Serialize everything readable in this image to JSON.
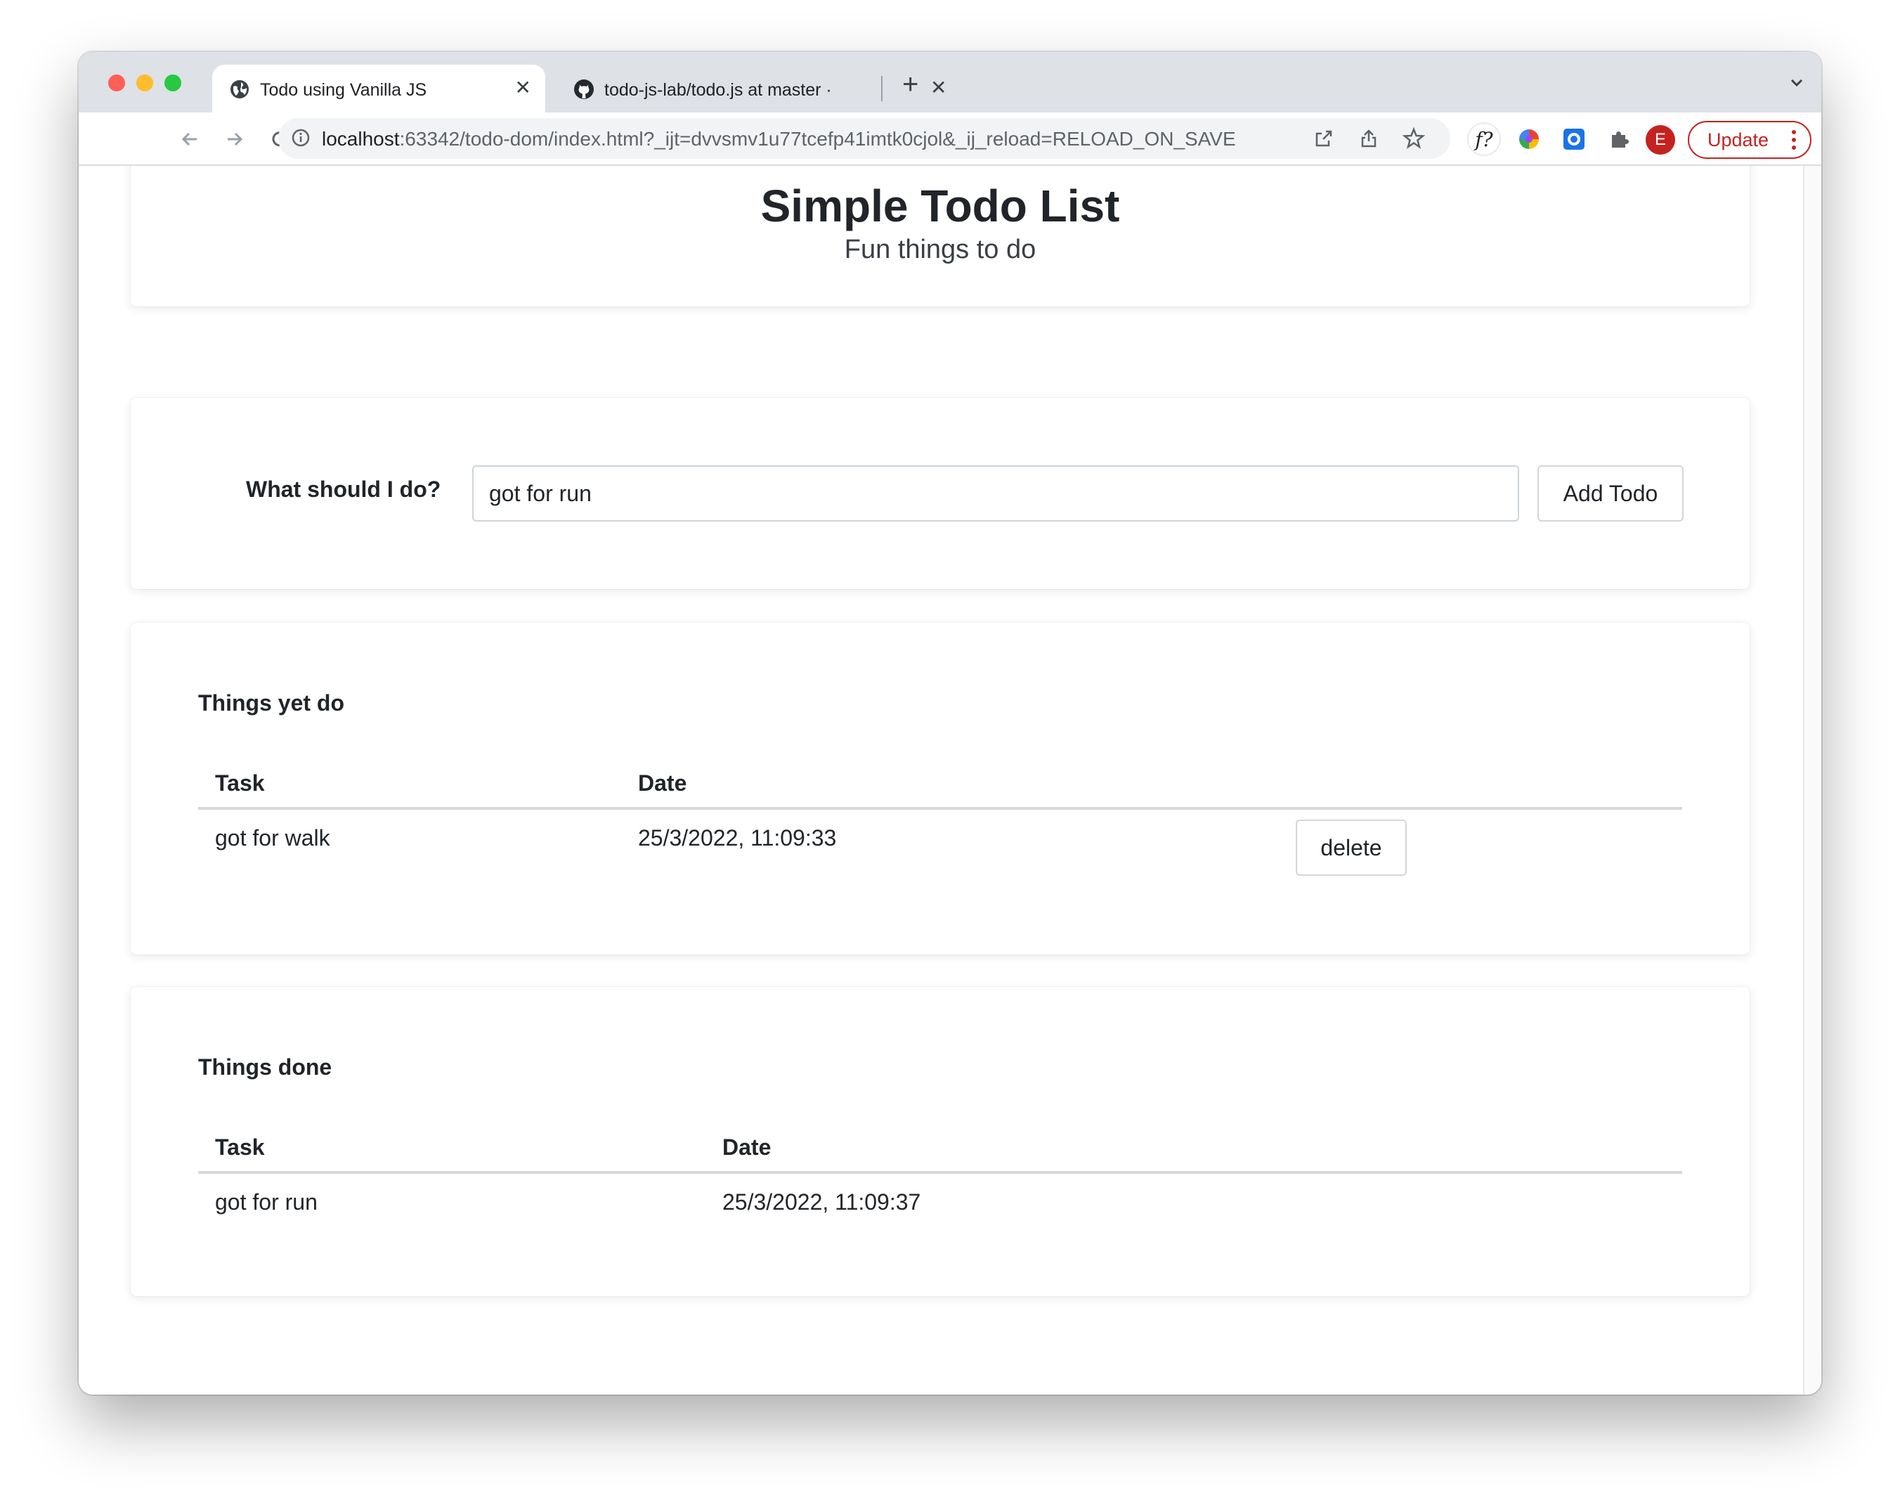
{
  "browser": {
    "tabs": [
      {
        "title": "Todo using Vanilla JS",
        "active": true,
        "icon": "globe-icon"
      },
      {
        "title": "todo-js-lab/todo.js at master · ",
        "active": false,
        "icon": "github-icon"
      }
    ],
    "new_tab_label": "+",
    "close_label": "✕",
    "url_host": "localhost",
    "url_rest": ":63342/todo-dom/index.html?_ijt=dvvsmv1u77tcefp41imtk0cjol&_ij_reload=RELOAD_ON_SAVE",
    "extension_label": "f?",
    "avatar_letter": "E",
    "update_label": "Update",
    "colors": {
      "update": "#c5221f",
      "tabstrip": "#dee1e6"
    }
  },
  "header": {
    "title": "Simple Todo List",
    "subtitle": "Fun things to do"
  },
  "form": {
    "label": "What should I do?",
    "input_value": "got for run",
    "add_button": "Add Todo"
  },
  "todo": {
    "title": "Things yet do",
    "columns": [
      "Task",
      "Date"
    ],
    "rows": [
      {
        "task": "got for walk",
        "date": "25/3/2022, 11:09:33",
        "action": "delete"
      }
    ]
  },
  "done": {
    "title": "Things done",
    "columns": [
      "Task",
      "Date"
    ],
    "rows": [
      {
        "task": "got for run",
        "date": "25/3/2022, 11:09:37"
      }
    ]
  }
}
